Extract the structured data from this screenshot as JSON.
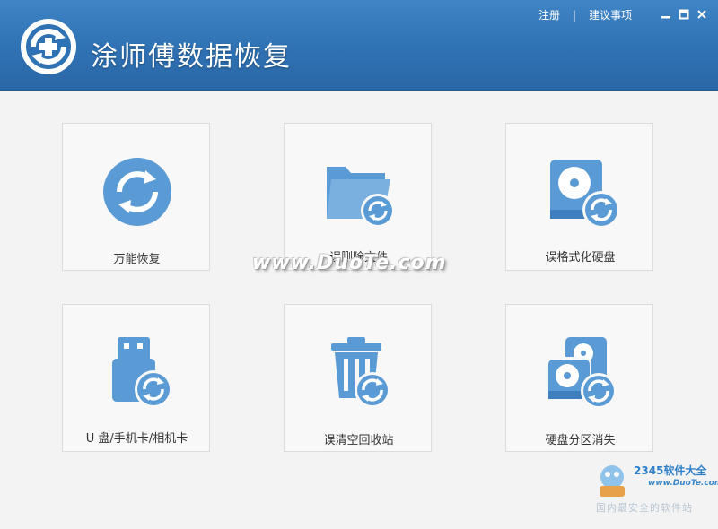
{
  "header": {
    "app_title": "涂师傅数据恢复",
    "register_label": "注册",
    "separator": "|",
    "feedback_label": "建议事项"
  },
  "window_controls": [
    "minimize-icon",
    "maximize-icon",
    "close-icon"
  ],
  "features": [
    {
      "label": "万能恢复",
      "icon": "universal-recovery-icon"
    },
    {
      "label": "误删除文件",
      "icon": "folder-restore-icon"
    },
    {
      "label": "误格式化硬盘",
      "icon": "disk-restore-icon"
    },
    {
      "label": "U 盘/手机卡/相机卡",
      "icon": "usb-restore-icon"
    },
    {
      "label": "误清空回收站",
      "icon": "recycle-bin-restore-icon"
    },
    {
      "label": "硬盘分区消失",
      "icon": "partition-restore-icon"
    }
  ],
  "watermark": {
    "duote": "www.DuoTe.com",
    "brand": "2345软件大全",
    "url": "www.DuoTe.com",
    "slogan": "国内最安全的软件站"
  },
  "colors": {
    "accent": "#5b9bd5",
    "titlebar": "#2f72b4"
  }
}
